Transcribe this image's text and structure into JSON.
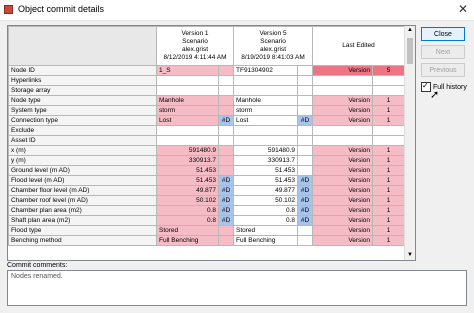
{
  "window": {
    "title": "Object commit details"
  },
  "buttons": {
    "close": "Close",
    "next": "Next",
    "previous": "Previous"
  },
  "full_history": {
    "label": "Full history",
    "checked": true
  },
  "comments": {
    "label": "Commit comments:",
    "value": "Nodes renamed."
  },
  "header": {
    "v1": [
      "Version 1",
      "Scenario",
      "alex.grist",
      "8/12/2019 4:11:44 AM"
    ],
    "v5": [
      "Version 5",
      "Scenario",
      "alex.grist",
      "8/19/2019 8:41:03 AM"
    ],
    "last": "Last Edited"
  },
  "rows": [
    {
      "label": "Node ID",
      "v1": "1_S",
      "v1c": "pink",
      "v1f": "",
      "v5": "TF91304902",
      "v5f": "",
      "lv": "Version",
      "ln": "5",
      "lc": "red"
    },
    {
      "label": "Hyperlinks",
      "v1": "",
      "v1c": "",
      "v1f": "",
      "v5": "",
      "v5f": "",
      "lv": "",
      "ln": "",
      "lc": ""
    },
    {
      "label": "Storage array",
      "v1": "",
      "v1c": "",
      "v1f": "",
      "v5": "",
      "v5f": "",
      "lv": "",
      "ln": "",
      "lc": ""
    },
    {
      "label": "Node type",
      "v1": "Manhole",
      "v1c": "pink",
      "v1f": "",
      "v5": "Manhole",
      "v5f": "",
      "lv": "Version",
      "ln": "1",
      "lc": "pink"
    },
    {
      "label": "System type",
      "v1": "storm",
      "v1c": "pink",
      "v1f": "",
      "v5": "storm",
      "v5f": "",
      "lv": "Version",
      "ln": "1",
      "lc": "pink"
    },
    {
      "label": "Connection type",
      "v1": "Lost",
      "v1c": "pink",
      "v1f": "#D",
      "v5": "Lost",
      "v5f": "#D",
      "lv": "Version",
      "ln": "1",
      "lc": "pink"
    },
    {
      "label": "Exclude",
      "v1": "",
      "v1c": "",
      "v1f": "",
      "v5": "",
      "v5f": "",
      "lv": "",
      "ln": "",
      "lc": ""
    },
    {
      "label": "Asset ID",
      "v1": "",
      "v1c": "",
      "v1f": "",
      "v5": "",
      "v5f": "",
      "lv": "",
      "ln": "",
      "lc": ""
    },
    {
      "label": "x (m)",
      "v1": "591480.9",
      "v1c": "pink",
      "v1f": "",
      "v5": "591480.9",
      "v5f": "",
      "lv": "Version",
      "ln": "1",
      "lc": "pink",
      "num": true
    },
    {
      "label": "y (m)",
      "v1": "330913.7",
      "v1c": "pink",
      "v1f": "",
      "v5": "330913.7",
      "v5f": "",
      "lv": "Version",
      "ln": "1",
      "lc": "pink",
      "num": true
    },
    {
      "label": "Ground level (m AD)",
      "v1": "51.453",
      "v1c": "pink",
      "v1f": "",
      "v5": "51.453",
      "v5f": "",
      "lv": "Version",
      "ln": "1",
      "lc": "pink",
      "num": true
    },
    {
      "label": "Flood level (m AD)",
      "v1": "51.453",
      "v1c": "pink",
      "v1f": "#D",
      "v5": "51.453",
      "v5f": "#D",
      "lv": "Version",
      "ln": "1",
      "lc": "pink",
      "num": true
    },
    {
      "label": "Chamber floor level (m AD)",
      "v1": "49.877",
      "v1c": "pink",
      "v1f": "#D",
      "v5": "49.877",
      "v5f": "#D",
      "lv": "Version",
      "ln": "1",
      "lc": "pink",
      "num": true
    },
    {
      "label": "Chamber roof level (m AD)",
      "v1": "50.102",
      "v1c": "pink",
      "v1f": "#D",
      "v5": "50.102",
      "v5f": "#D",
      "lv": "Version",
      "ln": "1",
      "lc": "pink",
      "num": true
    },
    {
      "label": "Chamber plan area (m2)",
      "v1": "0.8",
      "v1c": "pink",
      "v1f": "#D",
      "v5": "0.8",
      "v5f": "#D",
      "lv": "Version",
      "ln": "1",
      "lc": "pink",
      "num": true
    },
    {
      "label": "Shaft plan area (m2)",
      "v1": "0.8",
      "v1c": "pink",
      "v1f": "#D",
      "v5": "0.8",
      "v5f": "#D",
      "lv": "Version",
      "ln": "1",
      "lc": "pink",
      "num": true
    },
    {
      "label": "Flood type",
      "v1": "Stored",
      "v1c": "pink",
      "v1f": "",
      "v5": "Stored",
      "v5f": "",
      "lv": "Version",
      "ln": "1",
      "lc": "pink"
    },
    {
      "label": "Benching method",
      "v1": "Full Benching",
      "v1c": "pink",
      "v1f": "",
      "v5": "Full Benching",
      "v5f": "",
      "lv": "Version",
      "ln": "1",
      "lc": "pink"
    }
  ],
  "colors": {
    "changed": "#f6bcc6",
    "latest": "#ec7585",
    "flag": "#a9c4ea"
  }
}
